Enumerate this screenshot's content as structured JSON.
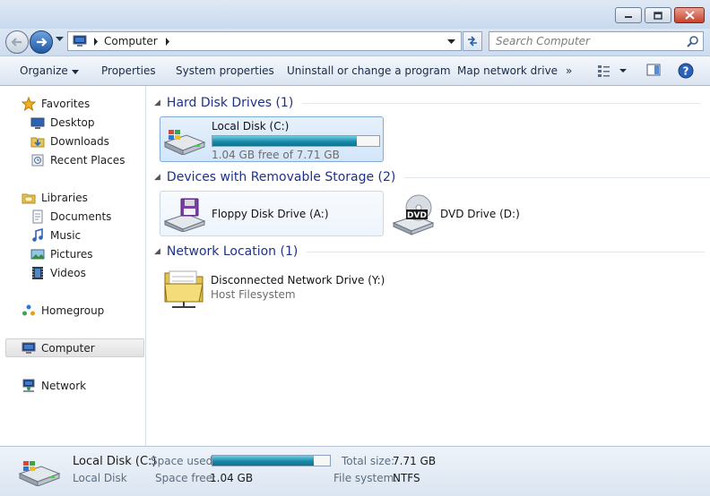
{
  "window": {
    "controls": {
      "minimize": "minimize-icon",
      "maximize": "maximize-icon",
      "close": "close-icon"
    }
  },
  "navigation": {
    "address_segments": [
      "Computer"
    ],
    "search_placeholder": "Search Computer"
  },
  "toolbar": {
    "organize": "Organize",
    "properties": "Properties",
    "system_properties": "System properties",
    "uninstall": "Uninstall or change a program",
    "map_drive": "Map network drive",
    "more": "»"
  },
  "sidebar": {
    "favorites": {
      "label": "Favorites",
      "items": [
        "Desktop",
        "Downloads",
        "Recent Places"
      ]
    },
    "libraries": {
      "label": "Libraries",
      "items": [
        "Documents",
        "Music",
        "Pictures",
        "Videos"
      ]
    },
    "homegroup": "Homegroup",
    "computer": "Computer",
    "network": "Network"
  },
  "groups": {
    "hard_disks": {
      "header": "Hard Disk Drives (1)",
      "items": [
        {
          "name": "Local Disk (C:)",
          "free_text": "1.04 GB free of 7.71 GB",
          "used_fraction": 0.865
        }
      ]
    },
    "removable": {
      "header": "Devices with Removable Storage (2)",
      "items": [
        {
          "name": "Floppy Disk Drive (A:)"
        },
        {
          "name": "DVD Drive (D:)",
          "badge": "DVD"
        }
      ]
    },
    "network": {
      "header": "Network Location (1)",
      "items": [
        {
          "name": "Disconnected Network Drive (Y:)",
          "sub": "Host Filesystem"
        }
      ]
    }
  },
  "details": {
    "name": "Local Disk (C:)",
    "type": "Local Disk",
    "space_used_label": "Space used:",
    "space_used_fraction": 0.865,
    "space_free_label": "Space free:",
    "space_free_value": "1.04 GB",
    "total_size_label": "Total size:",
    "total_size_value": "7.71 GB",
    "file_system_label": "File system:",
    "file_system_value": "NTFS"
  },
  "colors": {
    "accent": "#1e3287",
    "usage_bar": "#1a8aa9",
    "selection": "#d3e6f9"
  }
}
